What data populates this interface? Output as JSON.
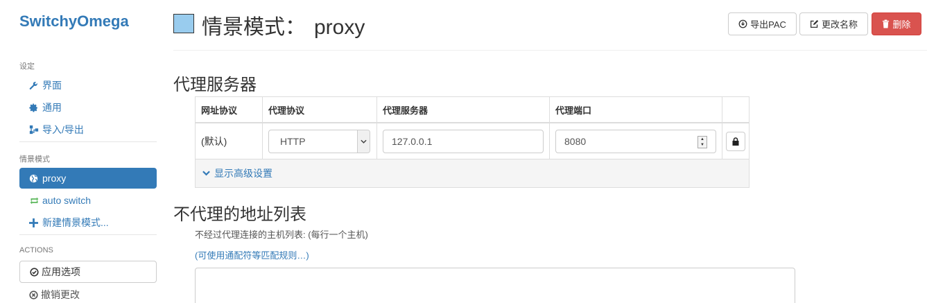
{
  "app": {
    "brand": "SwitchyOmega"
  },
  "sidebar": {
    "settings_header": "设定",
    "settings_items": [
      {
        "label": "界面",
        "icon": "wrench-icon"
      },
      {
        "label": "通用",
        "icon": "gear-icon"
      },
      {
        "label": "导入/导出",
        "icon": "sitemap-icon"
      }
    ],
    "profiles_header": "情景模式",
    "profiles": [
      {
        "label": "proxy",
        "icon": "globe-icon",
        "active": true
      },
      {
        "label": "auto switch",
        "icon": "refresh-icon"
      },
      {
        "label": "新建情景模式...",
        "icon": "plus-icon"
      }
    ],
    "actions_header": "ACTIONS",
    "apply_label": "应用选项",
    "discard_label": "撤销更改"
  },
  "header": {
    "title_prefix": "情景模式：",
    "profile_name": "proxy",
    "swatch_color": "#99ccee",
    "export_pac": "导出PAC",
    "rename": "更改名称",
    "delete": "删除"
  },
  "proxy_servers": {
    "title": "代理服务器",
    "columns": [
      "网址协议",
      "代理协议",
      "代理服务器",
      "代理端口"
    ],
    "row": {
      "scheme": "(默认)",
      "protocol": "HTTP",
      "host": "127.0.0.1",
      "port": "8080"
    },
    "advanced_label": "显示高级设置"
  },
  "bypass": {
    "title": "不代理的地址列表",
    "help": "不经过代理连接的主机列表: (每行一个主机)",
    "wildcard_link": "(可使用通配符等匹配规则…)",
    "value": ""
  },
  "colors": {
    "accent": "#337ab7",
    "danger": "#d9534f",
    "green": "#5cb85c"
  }
}
